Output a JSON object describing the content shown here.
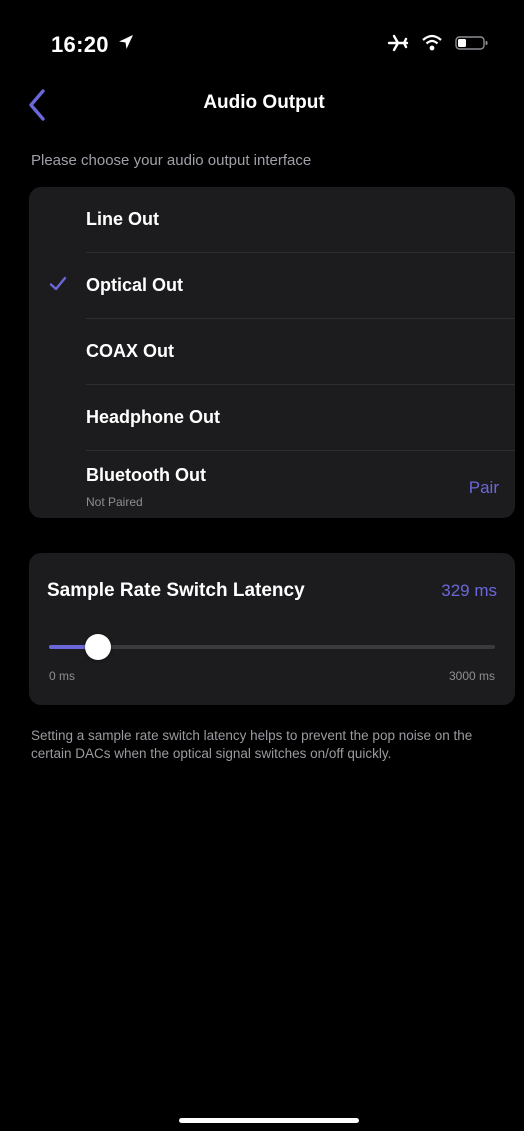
{
  "status_bar": {
    "time": "16:20"
  },
  "nav": {
    "title": "Audio Output"
  },
  "prompt": "Please choose your audio output interface",
  "outputs": [
    {
      "label": "Line Out",
      "selected": false
    },
    {
      "label": "Optical Out",
      "selected": true
    },
    {
      "label": "COAX Out",
      "selected": false
    },
    {
      "label": "Headphone Out",
      "selected": false
    },
    {
      "label": "Bluetooth Out",
      "sublabel": "Not Paired",
      "action": "Pair",
      "selected": false
    }
  ],
  "latency": {
    "title": "Sample Rate Switch Latency",
    "value_label": "329 ms",
    "value": 329,
    "min_label": "0 ms",
    "max_label": "3000 ms",
    "min": 0,
    "max": 3000
  },
  "note": "Setting a sample rate switch latency helps to prevent the pop noise on the certain DACs when the optical signal switches on/off quickly.",
  "colors": {
    "accent": "#6a68d8",
    "card": "#1c1c1e",
    "background": "#000000"
  }
}
